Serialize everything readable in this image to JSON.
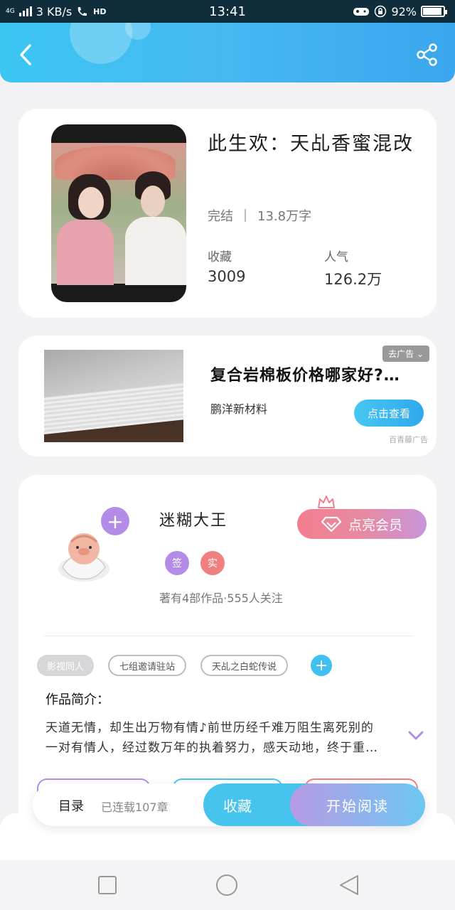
{
  "status_bar": {
    "network_type": "4G",
    "speed": "3 KB/s",
    "hd": "HD",
    "time": "13:41",
    "battery": "92%"
  },
  "header": {
    "back_icon": "chevron-left-icon",
    "share_icon": "share-icon"
  },
  "book": {
    "title": "此生欢：天乩香蜜混改",
    "status": "完结",
    "word_count": "13.8万字",
    "favorites_label": "收藏",
    "favorites_value": "3009",
    "popularity_label": "人气",
    "popularity_value": "126.2万"
  },
  "ad": {
    "tag": "去广告",
    "title": "复合岩棉板价格哪家好?…",
    "source": "鹏洋新材料",
    "button": "点击查看",
    "provider": "百青藤广告"
  },
  "author": {
    "name": "迷糊大王",
    "badge_sign": "签",
    "badge_real": "实",
    "stats": "著有4部作品·555人关注",
    "vip_button": "点亮会员",
    "tags": [
      "影视同人",
      "七组邀请驻站",
      "天乩之白蛇传说"
    ],
    "intro_heading": "作品简介：",
    "intro_line1": "天道无情，却生出万物有情♪前世历经千难万阻生离死别的",
    "intro_line2": "一对有情人，经过数万年的执着努力，感天动地，终于重…"
  },
  "action_bar": {
    "toc": "目录",
    "serial": "已连载107章",
    "collect": "收藏",
    "read": "开始阅读"
  },
  "colors": {
    "header_blue": "#3bc6f2",
    "purple": "#b28ce6",
    "pink": "#f37d8f",
    "cyan": "#46c4ee"
  }
}
